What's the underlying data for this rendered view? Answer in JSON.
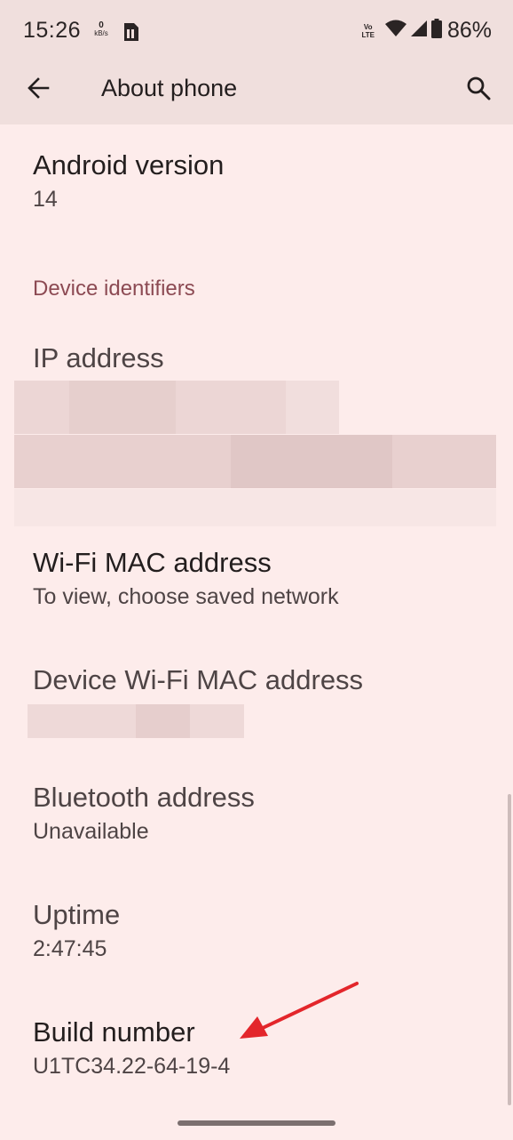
{
  "status_bar": {
    "time": "15:26",
    "net_speed_value": "0",
    "net_speed_unit": "kB/s",
    "volte_top": "Vo",
    "volte_bottom": "LTE",
    "battery": "86%"
  },
  "app_bar": {
    "title": "About phone",
    "back_icon": "arrow-back-icon",
    "search_icon": "search-icon"
  },
  "items": {
    "android_version": {
      "title": "Android version",
      "value": "14"
    },
    "section_header": "Device identifiers",
    "ip_address": {
      "title": "IP address"
    },
    "wifi_mac": {
      "title": "Wi-Fi MAC address",
      "value": "To view, choose saved network"
    },
    "device_wifi_mac": {
      "title": "Device Wi-Fi MAC address"
    },
    "bluetooth": {
      "title": "Bluetooth address",
      "value": "Unavailable"
    },
    "uptime": {
      "title": "Uptime",
      "value": "2:47:45"
    },
    "build_number": {
      "title": "Build number",
      "value": "U1TC34.22-64-19-4"
    }
  },
  "colors": {
    "background": "#fdeceb",
    "app_bar": "#f0dfdd",
    "section_header": "#8c4a53",
    "annotation_arrow": "#e3262b"
  }
}
